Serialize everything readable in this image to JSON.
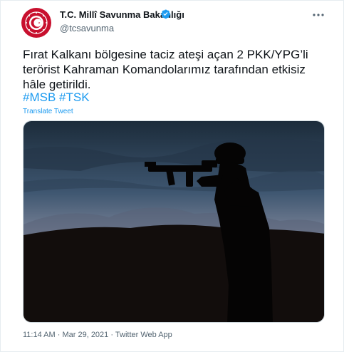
{
  "account": {
    "name": "T.C. Millî Savunma Bakanlığı",
    "handle": "@tcsavunma",
    "verified": true,
    "avatar_icon": "turkish-defense-emblem-icon",
    "avatar_color": "#c8102e"
  },
  "tweet": {
    "text": "Fırat Kalkanı bölgesine taciz ateşi açan 2 PKK/YPG’li terörist Kahraman Komandolarımız tarafından etkisiz hâle getirildi.",
    "hashtags": [
      "#MSB",
      "#TSK"
    ],
    "translate_label": "Translate Tweet",
    "time": "11:14 AM",
    "date": "Mar 29, 2021",
    "separator": "·",
    "source": "Twitter Web App"
  },
  "icons": {
    "more": "more-options-icon",
    "verified": "verified-badge-icon"
  },
  "colors": {
    "link": "#1d9bf0",
    "secondary_text": "#536471",
    "verified": "#1d9bf0"
  }
}
